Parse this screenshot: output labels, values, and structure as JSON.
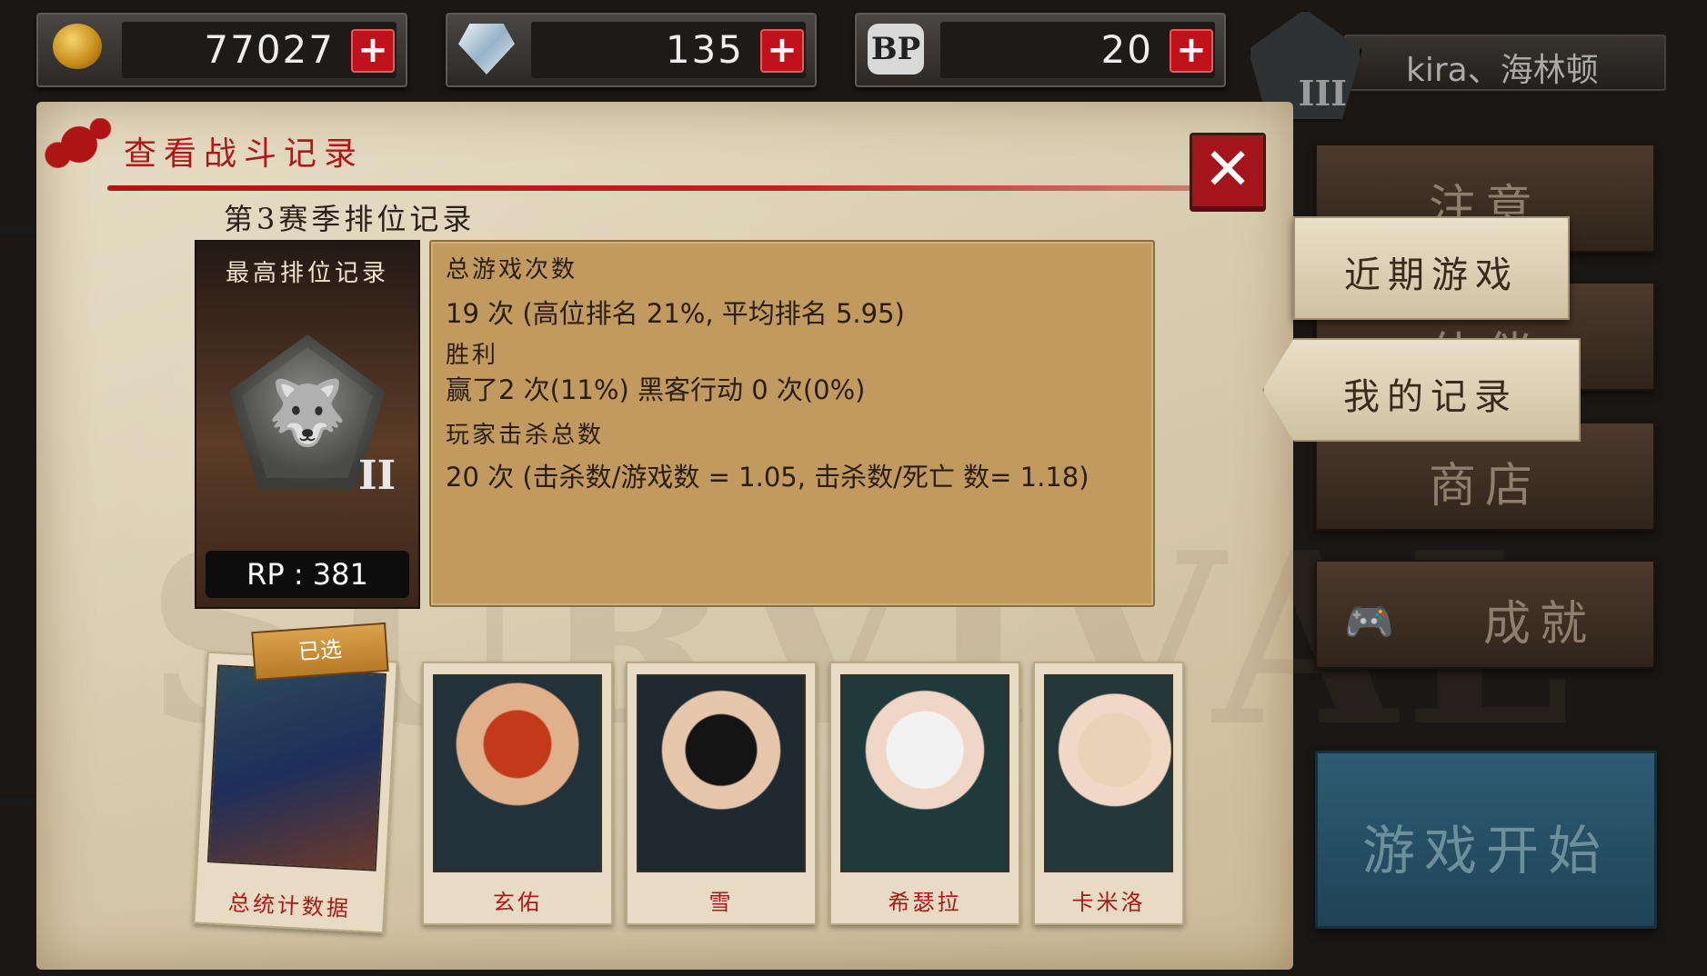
{
  "resources": {
    "gold": "77027",
    "gems": "135",
    "bp": "20",
    "bp_icon": "BP"
  },
  "player": {
    "name": "kira、海林顿",
    "rank_roman": "III"
  },
  "dialog": {
    "title": "查看战斗记录",
    "season_title": "第3赛季排位记录",
    "best_rank": {
      "header": "最高排位记录",
      "roman": "II",
      "rp": "RP : 381"
    },
    "stats": {
      "total_games_label": "总游戏次数",
      "total_games_value": "19 次 (高位排名 21%, 平均排名 5.95)",
      "wins_label": "胜利",
      "wins_value": "赢了2 次(11%) 黑客行动 0 次(0%)",
      "kills_label": "玩家击杀总数",
      "kills_value": "20 次 (击杀数/游戏数 = 1.05, 击杀数/死亡 数= 1.18)"
    },
    "selected_tag": "已选",
    "characters": [
      {
        "name": "总统计数据"
      },
      {
        "name": "玄佑"
      },
      {
        "name": "雪"
      },
      {
        "name": "希瑟拉"
      },
      {
        "name": "卡米洛"
      }
    ],
    "watermark": "SURVIVAL"
  },
  "menu": {
    "notice": "注意",
    "recent_games": "近期游戏",
    "partial_hidden": "伙伴",
    "my_records": "我的记录",
    "shop": "商店",
    "achievements": "成就",
    "start_game": "游戏开始"
  },
  "colors": {
    "accent_red": "#b01818",
    "parchment": "#d8ccaf",
    "stats_box": "#c09a5e",
    "start_button": "#2e5c73"
  }
}
